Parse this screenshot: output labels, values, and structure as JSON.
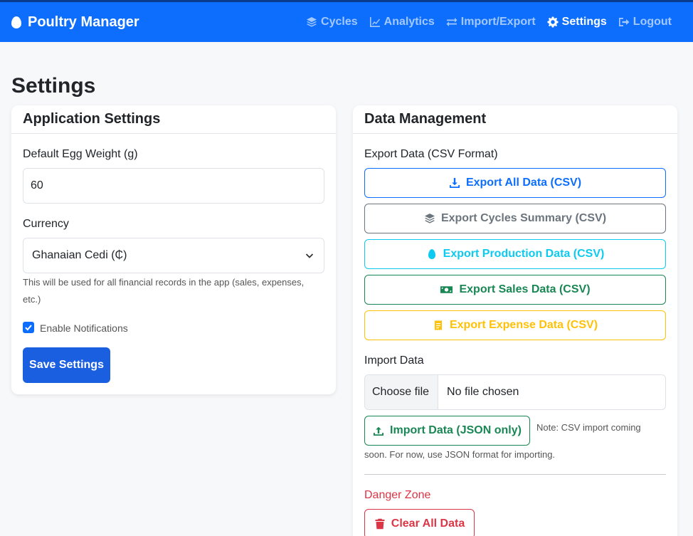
{
  "brand": {
    "name": "Poultry Manager"
  },
  "nav": {
    "cycles": "Cycles",
    "analytics": "Analytics",
    "import_export": "Import/Export",
    "settings": "Settings",
    "logout": "Logout"
  },
  "page": {
    "title": "Settings"
  },
  "app_settings": {
    "title": "Application Settings",
    "egg_weight_label": "Default Egg Weight (g)",
    "egg_weight_value": "60",
    "currency_label": "Currency",
    "currency_value": "Ghanaian Cedi (₵)",
    "currency_help": "This will be used for all financial records in the app (sales, expenses, etc.)",
    "notifications_label": "Enable Notifications",
    "notifications_checked": true,
    "save_label": "Save Settings"
  },
  "data_mgmt": {
    "title": "Data Management",
    "export_label": "Export Data (CSV Format)",
    "export_all": "Export All Data (CSV)",
    "export_cycles": "Export Cycles Summary (CSV)",
    "export_production": "Export Production Data (CSV)",
    "export_sales": "Export Sales Data (CSV)",
    "export_expense": "Export Expense Data (CSV)",
    "import_label": "Import Data",
    "choose_file": "Choose file",
    "no_file": "No file chosen",
    "import_button": "Import Data (JSON only)",
    "import_note_1": "Note: CSV import coming",
    "import_note_2": "soon. For now, use JSON format for importing.",
    "danger_label": "Danger Zone",
    "clear_button": "Clear All Data"
  },
  "colors": {
    "primary": "#0d6efd",
    "secondary": "#6c757d",
    "info": "#0dcaf0",
    "success": "#198754",
    "warning": "#ffc107",
    "danger": "#dc3545"
  }
}
